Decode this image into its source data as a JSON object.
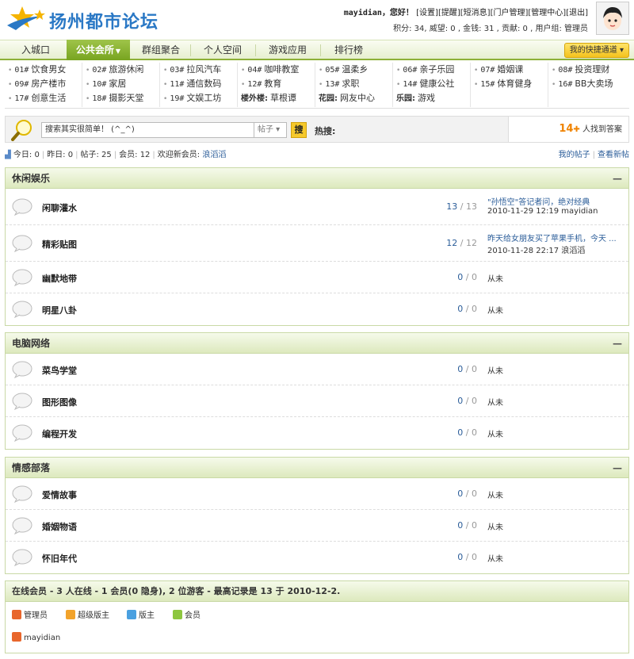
{
  "site": {
    "logo_text": "扬州都市论坛"
  },
  "userbar": {
    "username": "mayidian",
    "greeting": "，您好！",
    "links": [
      "[设置]",
      "[提醒]",
      "[短消息]",
      "[门户管理]",
      "[管理中心]",
      "[退出]"
    ],
    "stats": "积分: 34, 威望: 0 , 金钱: 31 , 贡献: 0 , 用户组: 管理员"
  },
  "nav": {
    "items": [
      "入城口",
      "公共会所",
      "群组聚合",
      "个人空间",
      "游戏应用",
      "排行榜"
    ],
    "active_index": 1,
    "quick": "我的快捷通道 ▾"
  },
  "submenu": {
    "items": [
      [
        "01#",
        "饮食男女"
      ],
      [
        "02#",
        "旅游休闲"
      ],
      [
        "03#",
        "拉风汽车"
      ],
      [
        "04#",
        "咖啡教室"
      ],
      [
        "05#",
        "温柔乡"
      ],
      [
        "06#",
        "亲子乐园"
      ],
      [
        "07#",
        "婚姻课"
      ],
      [
        "08#",
        "投资理财"
      ],
      [
        "09#",
        "房产楼市"
      ],
      [
        "10#",
        "家居"
      ],
      [
        "11#",
        "通信数码"
      ],
      [
        "12#",
        "教育"
      ],
      [
        "13#",
        "求职"
      ],
      [
        "14#",
        "健康公社"
      ],
      [
        "15#",
        "体育健身"
      ],
      [
        "16#",
        "BB大卖场"
      ],
      [
        "17#",
        "创意生活"
      ],
      [
        "18#",
        "摄影天堂"
      ],
      [
        "19#",
        "文娱工坊"
      ],
      [
        "楼外楼:",
        "草根谭"
      ],
      [
        "花园:",
        "网友中心"
      ],
      [
        "乐园:",
        "游戏"
      ]
    ]
  },
  "search": {
    "placeholder": "搜索其实很简单！ (^_^)",
    "select": "帖子 ▾",
    "button": "搜",
    "hot_label": "热搜:",
    "answer_count": "14",
    "answer_text": " 人找到答案"
  },
  "info": {
    "today": "今日: 0",
    "yesterday": "昨日: 0",
    "posts": "帖子: 25",
    "members": "会员: 12",
    "welcome": "欢迎新会员:",
    "new_member": "浪滔滔",
    "my_posts": "我的帖子",
    "new_posts": "查看新帖"
  },
  "groups": [
    {
      "title": "休闲娱乐",
      "forums": [
        {
          "name": "闲聊灌水",
          "a": "13",
          "b": "13",
          "last_title": "\"孙悟空\"答记者问，绝对经典",
          "last_info": "2010-11-29 12:19 mayidian"
        },
        {
          "name": "精彩贴图",
          "a": "12",
          "b": "12",
          "last_title": "昨天给女朋友买了苹果手机，今天 ...",
          "last_info": "2010-11-28 22:17 浪滔滔"
        },
        {
          "name": "幽默地带",
          "a": "0",
          "b": "0",
          "last_title": "",
          "last_info": "从未"
        },
        {
          "name": "明星八卦",
          "a": "0",
          "b": "0",
          "last_title": "",
          "last_info": "从未"
        }
      ]
    },
    {
      "title": "电脑网络",
      "forums": [
        {
          "name": "菜鸟学堂",
          "a": "0",
          "b": "0",
          "last_title": "",
          "last_info": "从未"
        },
        {
          "name": "图形图像",
          "a": "0",
          "b": "0",
          "last_title": "",
          "last_info": "从未"
        },
        {
          "name": "编程开发",
          "a": "0",
          "b": "0",
          "last_title": "",
          "last_info": "从未"
        }
      ]
    },
    {
      "title": "情感部落",
      "forums": [
        {
          "name": "爱情故事",
          "a": "0",
          "b": "0",
          "last_title": "",
          "last_info": "从未"
        },
        {
          "name": "婚姻物语",
          "a": "0",
          "b": "0",
          "last_title": "",
          "last_info": "从未"
        },
        {
          "name": "怀旧年代",
          "a": "0",
          "b": "0",
          "last_title": "",
          "last_info": "从未"
        }
      ]
    }
  ],
  "online": {
    "title": "在线会员 - 3 人在线 - 1 会员(0 隐身), 2 位游客 - 最高记录是 13 于 2010-12-2.",
    "legend": [
      {
        "label": "管理员",
        "color": "#e8662c"
      },
      {
        "label": "超级版主",
        "color": "#f2a32b"
      },
      {
        "label": "版主",
        "color": "#4aa0e0"
      },
      {
        "label": "会员",
        "color": "#8dc63f"
      }
    ],
    "user": "mayidian"
  },
  "colors": {
    "accent": "#8db037",
    "link": "#2b5d99",
    "highlight": "#f08300"
  }
}
